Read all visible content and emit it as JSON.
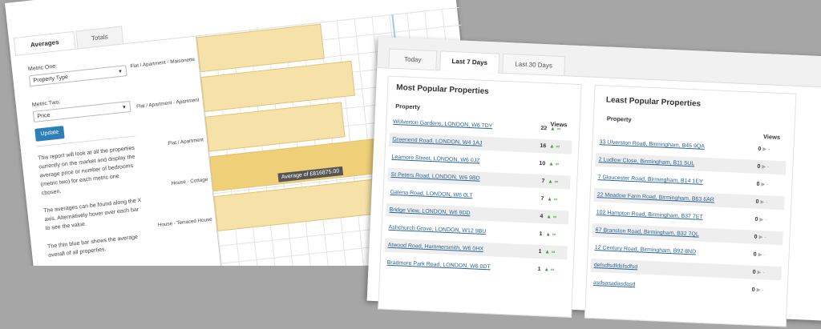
{
  "averages_panel": {
    "tabs": [
      {
        "label": "Averages",
        "active": true
      },
      {
        "label": "Totals",
        "active": false
      }
    ],
    "metric_one": {
      "label": "Metric One:",
      "value": "Property Type"
    },
    "metric_two": {
      "label": "Metric Two:",
      "value": "Price"
    },
    "update_label": "Update",
    "description": [
      "This report will look at all the properties currently on the market and display the average price or number of bedrooms (metric two) for each metric one chosen.",
      "The averages can be found along the X axis. Alternatively hover over each bar to see the value.",
      "The thin blue bar shows the average overall of all properties."
    ],
    "tooltip": "Average of £816875.00",
    "colors": {
      "bar": "#f6e2a8",
      "bar_highlight": "#efcf78",
      "average_line": "#9ecae8",
      "update_button": "#2e7fb8"
    }
  },
  "chart_data": {
    "type": "bar",
    "orientation": "horizontal",
    "categories": [
      "Flat / Apartment - Maisonette",
      "Flat / Apartment - Apartment",
      "Flat / Apartment",
      "House - Cottage",
      "House - Terraced House"
    ],
    "values": [
      520000,
      630000,
      570000,
      816875,
      1050000
    ],
    "highlighted_category": "House - Cottage",
    "grid": true
  },
  "popular_panel": {
    "tabs": [
      {
        "label": "Today",
        "active": false
      },
      {
        "label": "Last 7 Days",
        "active": true
      },
      {
        "label": "Last 30 Days",
        "active": false
      }
    ],
    "most": {
      "title": "Most Popular Properties",
      "col_property": "Property",
      "col_views": "Views",
      "rows": [
        {
          "address": "Wolverton Gardens, LONDON, W6 7DY",
          "views": "22",
          "trend": "▲ ∞"
        },
        {
          "address": "Greenend Road, LONDON, W4 1AJ",
          "views": "16",
          "trend": "▲ ∞"
        },
        {
          "address": "Leamore Street, LONDON, W6 0JZ",
          "views": "10",
          "trend": "▲ ∞"
        },
        {
          "address": "St Peters Road, LONDON, W6 9BD",
          "views": "7",
          "trend": "▲ ∞"
        },
        {
          "address": "Galena Road, LONDON, W6 0LT",
          "views": "7",
          "trend": "▲ ∞"
        },
        {
          "address": "Bridge View, LONDON, W6 9DD",
          "views": "4",
          "trend": "▲ ∞"
        },
        {
          "address": "Ashchurch Grove, LONDON, W12 9BU",
          "views": "1",
          "trend": "▲ ∞"
        },
        {
          "address": "Atwood Road, Hammersmith, W6 0HX",
          "views": "1",
          "trend": "▲ ∞"
        },
        {
          "address": "Bradmore Park Road, LONDON, W6 0DT",
          "views": "1",
          "trend": "▲ ∞"
        }
      ]
    },
    "least": {
      "title": "Least Popular Properties",
      "col_property": "Property",
      "col_views": "Views",
      "rows": [
        {
          "address": "33 Ulverston Road, Birmingham, B45 9QA",
          "views": "0",
          "trend": "▶ -"
        },
        {
          "address": "2 Ludlow Close, Birmingham, B11 5UL",
          "views": "0",
          "trend": "▶ -"
        },
        {
          "address": "7 Gloucester Road, Birmingham, B14 1EY",
          "views": "0",
          "trend": "▶ -"
        },
        {
          "address": "22 Meadow Farm Road, Birmingham, B63 6AR",
          "views": "0",
          "trend": "▶ -"
        },
        {
          "address": "102 Hampton Road, Birmingham, B37 7ET",
          "views": "0",
          "trend": "▶ -"
        },
        {
          "address": "67 Branston Road, Birmingham, B32 7QL",
          "views": "0",
          "trend": "▶ -"
        },
        {
          "address": "12 Century Road, Birmingham, B92 8ND",
          "views": "0",
          "trend": "▶ -"
        },
        {
          "address": "defsdfsdfdsfsdfsd",
          "views": "0",
          "trend": "▶ -"
        },
        {
          "address": "asdsasadasdasd",
          "views": "0",
          "trend": "▶ -"
        }
      ]
    },
    "colors": {
      "trend_up": "#3a9a3a",
      "trend_flat": "#aaaaaa",
      "row_alt": "#eeeeee",
      "link": "#2a6496"
    }
  }
}
